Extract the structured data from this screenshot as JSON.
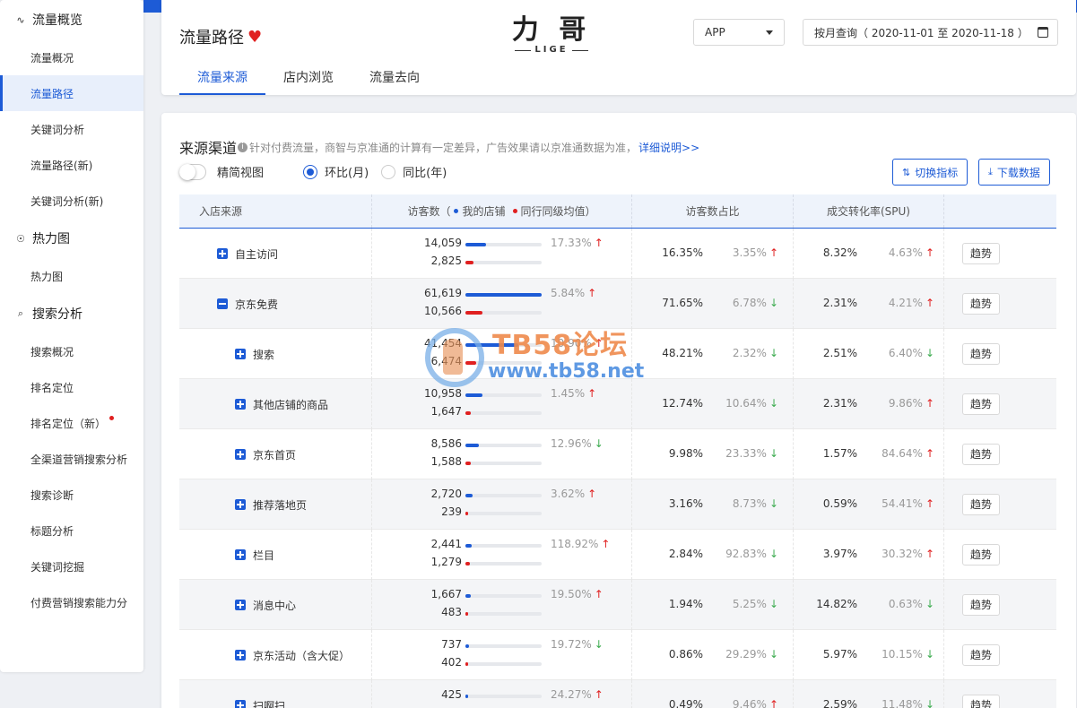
{
  "sidebar": {
    "sections": [
      {
        "label": "流量概览",
        "icon": "pulse-icon",
        "items": [
          {
            "label": "流量概况",
            "active": false
          },
          {
            "label": "流量路径",
            "active": true
          },
          {
            "label": "关键词分析",
            "active": false
          },
          {
            "label": "流量路径(新)",
            "active": false
          },
          {
            "label": "关键词分析(新)",
            "active": false
          }
        ]
      },
      {
        "label": "热力图",
        "icon": "heatmap-icon",
        "items": [
          {
            "label": "热力图",
            "active": false
          }
        ]
      },
      {
        "label": "搜索分析",
        "icon": "search-analysis-icon",
        "items": [
          {
            "label": "搜索概况",
            "active": false
          },
          {
            "label": "排名定位",
            "active": false
          },
          {
            "label": "排名定位（新）",
            "active": false,
            "badge": true
          },
          {
            "label": "全渠道营销搜索分析",
            "active": false
          },
          {
            "label": "搜索诊断",
            "active": false
          },
          {
            "label": "标题分析",
            "active": false
          },
          {
            "label": "关键词挖掘",
            "active": false
          },
          {
            "label": "付费营销搜索能力分",
            "active": false
          }
        ]
      }
    ]
  },
  "header": {
    "title": "流量路径",
    "logo_zh": "力 哥",
    "logo_en": "LIGE",
    "platform": "APP",
    "date_range": "按月查询（ 2020-11-01 至 2020-11-18 ）",
    "tabs": [
      {
        "label": "流量来源",
        "active": true
      },
      {
        "label": "店内浏览",
        "active": false
      },
      {
        "label": "流量去向",
        "active": false
      }
    ]
  },
  "section": {
    "title": "来源渠道",
    "note": "针对付费流量，商智与京准通的计算有一定差异，广告效果请以京准通数据为准，",
    "link": "详细说明>>",
    "simple_view": "精简视图",
    "radio_mom": "环比(月)",
    "radio_yoy": "同比(年)",
    "btn_switch": "切换指标",
    "btn_download": "下载数据"
  },
  "table": {
    "headers": {
      "source": "入店来源",
      "visitors_label": "访客数（",
      "legend_mine": "我的店铺",
      "legend_peer": "同行同级均值",
      "visitors_end": "）",
      "share": "访客数占比",
      "conversion": "成交转化率(SPU)"
    },
    "trend_label": "趋势",
    "rows": [
      {
        "name": "自主访问",
        "level": 0,
        "expand": "plus",
        "mine": "14,059",
        "peer": "2,825",
        "mine_ratio": 0.27,
        "peer_ratio": 0.11,
        "change": "17.33%",
        "dir": "up",
        "share": "16.35%",
        "share_chg": "3.35%",
        "share_dir": "up",
        "conv": "8.32%",
        "conv_chg": "4.63%",
        "conv_dir": "up"
      },
      {
        "name": "京东免费",
        "level": 0,
        "expand": "minus",
        "mine": "61,619",
        "peer": "10,566",
        "mine_ratio": 1.0,
        "peer_ratio": 0.22,
        "change": "5.84%",
        "dir": "up",
        "share": "71.65%",
        "share_chg": "6.78%",
        "share_dir": "down",
        "conv": "2.31%",
        "conv_chg": "4.21%",
        "conv_dir": "up"
      },
      {
        "name": "搜索",
        "level": 1,
        "expand": "plus",
        "mine": "41,454",
        "peer": "6,474",
        "mine_ratio": 0.69,
        "peer_ratio": 0.14,
        "change": "10.90%",
        "dir": "up",
        "share": "48.21%",
        "share_chg": "2.32%",
        "share_dir": "down",
        "conv": "2.51%",
        "conv_chg": "6.40%",
        "conv_dir": "down"
      },
      {
        "name": "其他店铺的商品",
        "level": 1,
        "expand": "plus",
        "mine": "10,958",
        "peer": "1,647",
        "mine_ratio": 0.22,
        "peer_ratio": 0.07,
        "change": "1.45%",
        "dir": "up",
        "share": "12.74%",
        "share_chg": "10.64%",
        "share_dir": "down",
        "conv": "2.31%",
        "conv_chg": "9.86%",
        "conv_dir": "up"
      },
      {
        "name": "京东首页",
        "level": 1,
        "expand": "plus",
        "mine": "8,586",
        "peer": "1,588",
        "mine_ratio": 0.18,
        "peer_ratio": 0.07,
        "change": "12.96%",
        "dir": "down",
        "share": "9.98%",
        "share_chg": "23.33%",
        "share_dir": "down",
        "conv": "1.57%",
        "conv_chg": "84.64%",
        "conv_dir": "up"
      },
      {
        "name": "推荐落地页",
        "level": 1,
        "expand": "plus",
        "mine": "2,720",
        "peer": "239",
        "mine_ratio": 0.09,
        "peer_ratio": 0.03,
        "change": "3.62%",
        "dir": "up",
        "share": "3.16%",
        "share_chg": "8.73%",
        "share_dir": "down",
        "conv": "0.59%",
        "conv_chg": "54.41%",
        "conv_dir": "up"
      },
      {
        "name": "栏目",
        "level": 1,
        "expand": "plus",
        "mine": "2,441",
        "peer": "1,279",
        "mine_ratio": 0.08,
        "peer_ratio": 0.06,
        "change": "118.92%",
        "dir": "up",
        "share": "2.84%",
        "share_chg": "92.83%",
        "share_dir": "down",
        "conv": "3.97%",
        "conv_chg": "30.32%",
        "conv_dir": "up"
      },
      {
        "name": "消息中心",
        "level": 1,
        "expand": "plus",
        "mine": "1,667",
        "peer": "483",
        "mine_ratio": 0.07,
        "peer_ratio": 0.04,
        "change": "19.50%",
        "dir": "up",
        "share": "1.94%",
        "share_chg": "5.25%",
        "share_dir": "down",
        "conv": "14.82%",
        "conv_chg": "0.63%",
        "conv_dir": "down"
      },
      {
        "name": "京东活动（含大促）",
        "level": 1,
        "expand": "plus",
        "mine": "737",
        "peer": "402",
        "mine_ratio": 0.05,
        "peer_ratio": 0.04,
        "change": "19.72%",
        "dir": "down",
        "share": "0.86%",
        "share_chg": "29.29%",
        "share_dir": "down",
        "conv": "5.97%",
        "conv_chg": "10.15%",
        "conv_dir": "down"
      },
      {
        "name": "扫啊扫",
        "level": 1,
        "expand": "plus",
        "mine": "425",
        "peer": "",
        "mine_ratio": 0.04,
        "peer_ratio": 0.0,
        "change": "24.27%",
        "dir": "up",
        "share": "0.49%",
        "share_chg": "9.46%",
        "share_dir": "up",
        "conv": "2.59%",
        "conv_chg": "11.48%",
        "conv_dir": "down"
      }
    ]
  },
  "watermark": {
    "title": "TB58论坛",
    "url": "www.tb58.net"
  },
  "colors": {
    "accent": "#1d5bd6",
    "up": "#e02020",
    "down": "#3cab4f"
  }
}
